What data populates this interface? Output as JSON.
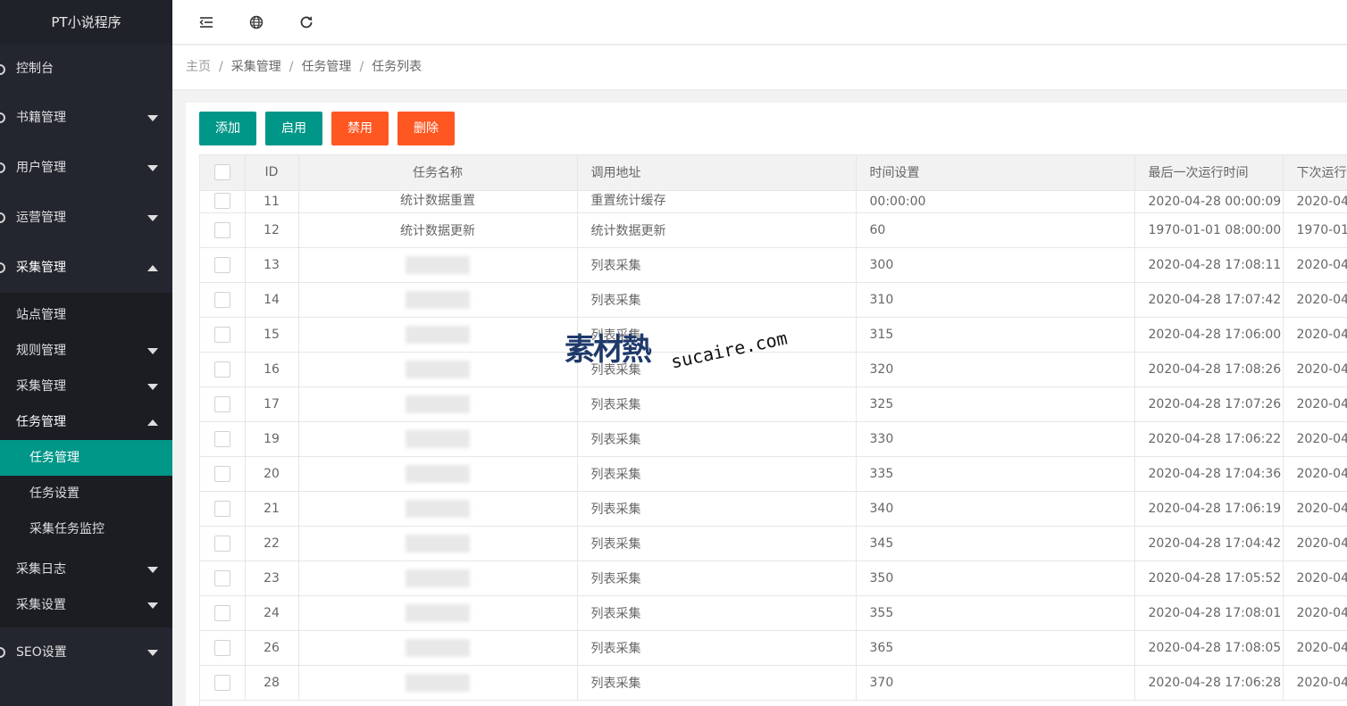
{
  "app": {
    "title": "PT小说程序"
  },
  "sidebar": {
    "items": [
      {
        "label": "控制台"
      },
      {
        "label": "书籍管理"
      },
      {
        "label": "用户管理"
      },
      {
        "label": "运营管理"
      },
      {
        "label": "采集管理"
      },
      {
        "label": "SEO设置"
      }
    ],
    "sub": [
      {
        "label": "站点管理"
      },
      {
        "label": "规则管理"
      },
      {
        "label": "采集管理"
      },
      {
        "label": "任务管理"
      },
      {
        "label": "采集日志"
      },
      {
        "label": "采集设置"
      }
    ],
    "subsub": [
      {
        "label": "任务管理"
      },
      {
        "label": "任务设置"
      },
      {
        "label": "采集任务监控"
      }
    ]
  },
  "topbar": {
    "icons": [
      "menu-collapse-icon",
      "globe-icon",
      "refresh-icon"
    ]
  },
  "breadcrumb": [
    "主页",
    "采集管理",
    "任务管理",
    "任务列表"
  ],
  "toolbar": {
    "add": "添加",
    "enable": "启用",
    "disable": "禁用",
    "delete": "删除"
  },
  "colors": {
    "primary": "#009688",
    "danger": "#ff5722",
    "sidebar": "#23262e"
  },
  "table": {
    "headers": [
      "ID",
      "任务名称",
      "调用地址",
      "时间设置",
      "最后一次运行时间",
      "下次运行"
    ],
    "rows": [
      {
        "id": "11",
        "name": "统计数据重置",
        "url": "重置统计缓存",
        "time": "00:00:00",
        "last": "2020-04-28 00:00:09",
        "next": "2020-04-"
      },
      {
        "id": "12",
        "name": "统计数据更新",
        "url": "统计数据更新",
        "time": "60",
        "last": "1970-01-01 08:00:00",
        "next": "1970-01-"
      },
      {
        "id": "13",
        "name": "",
        "url": "列表采集",
        "time": "300",
        "last": "2020-04-28 17:08:11",
        "next": "2020-04-"
      },
      {
        "id": "14",
        "name": "",
        "url": "列表采集",
        "time": "310",
        "last": "2020-04-28 17:07:42",
        "next": "2020-04-"
      },
      {
        "id": "15",
        "name": "",
        "url": "列表采集",
        "time": "315",
        "last": "2020-04-28 17:06:00",
        "next": "2020-04-"
      },
      {
        "id": "16",
        "name": "",
        "url": "列表采集",
        "time": "320",
        "last": "2020-04-28 17:08:26",
        "next": "2020-04-"
      },
      {
        "id": "17",
        "name": "",
        "url": "列表采集",
        "time": "325",
        "last": "2020-04-28 17:07:26",
        "next": "2020-04-"
      },
      {
        "id": "19",
        "name": "",
        "url": "列表采集",
        "time": "330",
        "last": "2020-04-28 17:06:22",
        "next": "2020-04-"
      },
      {
        "id": "20",
        "name": "",
        "url": "列表采集",
        "time": "335",
        "last": "2020-04-28 17:04:36",
        "next": "2020-04-"
      },
      {
        "id": "21",
        "name": "",
        "url": "列表采集",
        "time": "340",
        "last": "2020-04-28 17:06:19",
        "next": "2020-04-"
      },
      {
        "id": "22",
        "name": "",
        "url": "列表采集",
        "time": "345",
        "last": "2020-04-28 17:04:42",
        "next": "2020-04-"
      },
      {
        "id": "23",
        "name": "",
        "url": "列表采集",
        "time": "350",
        "last": "2020-04-28 17:05:52",
        "next": "2020-04-"
      },
      {
        "id": "24",
        "name": "",
        "url": "列表采集",
        "time": "355",
        "last": "2020-04-28 17:08:01",
        "next": "2020-04-"
      },
      {
        "id": "26",
        "name": "",
        "url": "列表采集",
        "time": "365",
        "last": "2020-04-28 17:08:05",
        "next": "2020-04-"
      },
      {
        "id": "28",
        "name": "",
        "url": "列表采集",
        "time": "370",
        "last": "2020-04-28 17:06:28",
        "next": "2020-04-"
      }
    ]
  },
  "watermark": {
    "brand": "素材熱",
    "domain": "sucaire.com"
  }
}
